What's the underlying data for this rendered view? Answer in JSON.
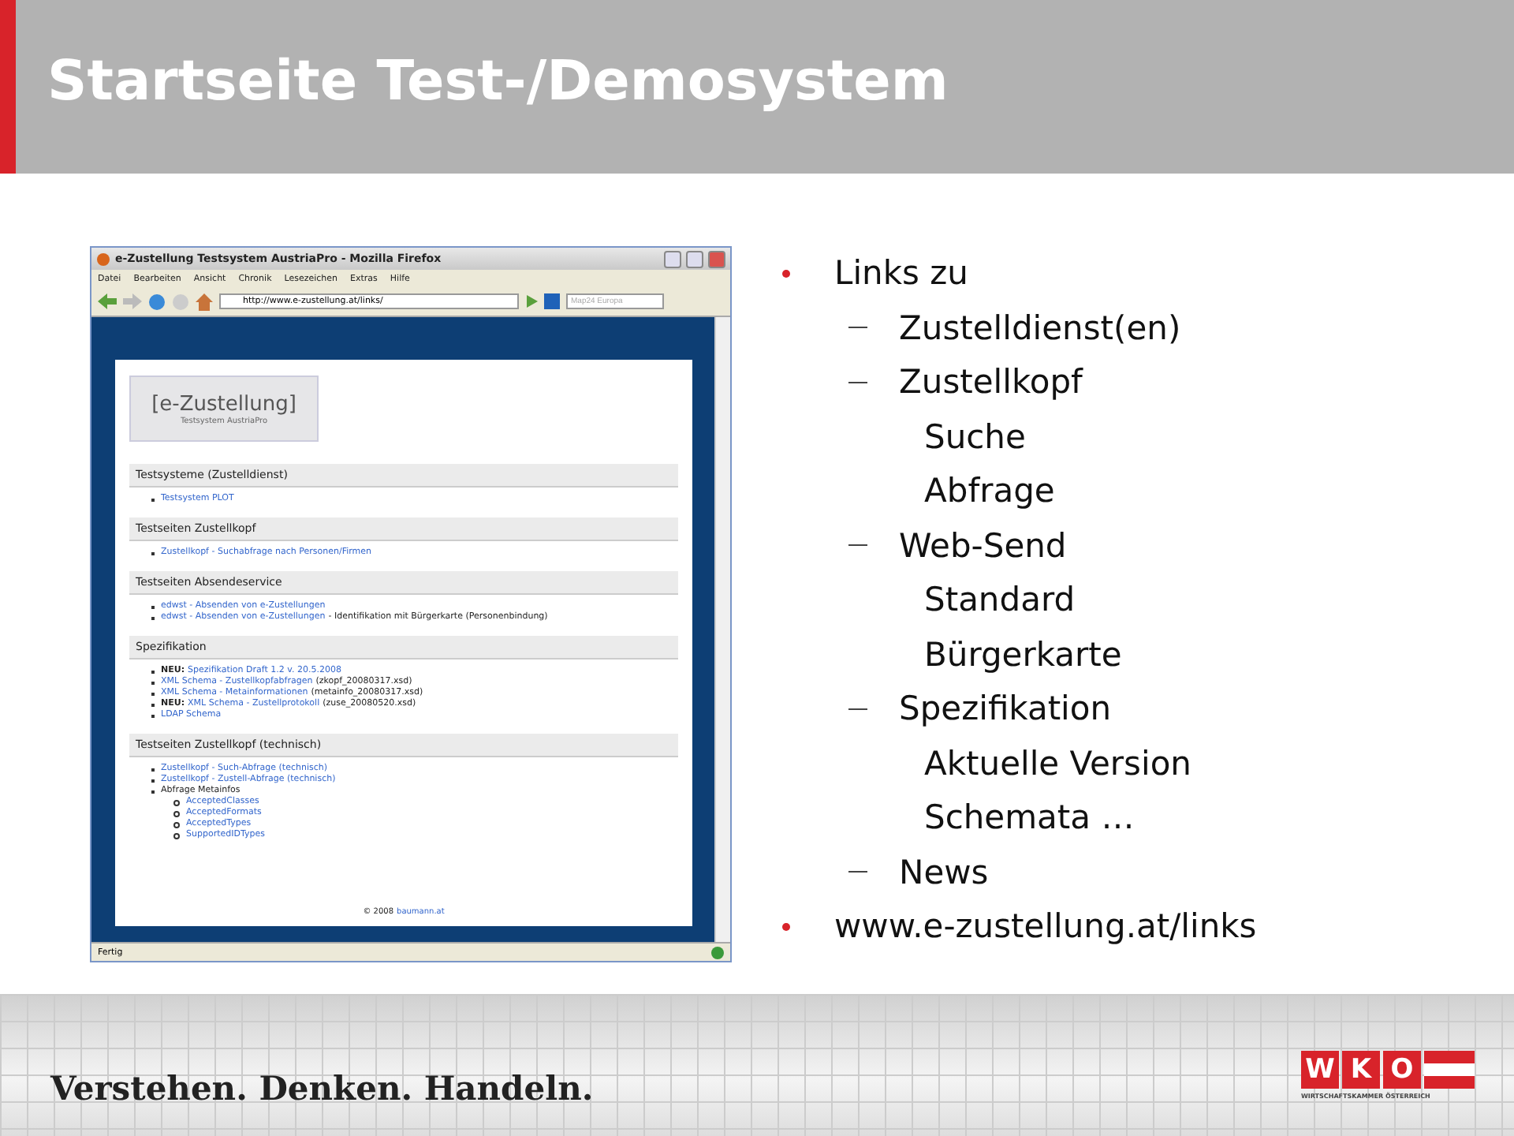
{
  "header": {
    "title": "Startseite Test-/Demosystem"
  },
  "browser": {
    "title": "e-Zustellung Testsystem AustriaPro - Mozilla Firefox",
    "menu": [
      "Datei",
      "Bearbeiten",
      "Ansicht",
      "Chronik",
      "Lesezeichen",
      "Extras",
      "Hilfe"
    ],
    "url": "http://www.e-zustellung.at/links/",
    "search": {
      "placeholder": "Map24 Europa"
    },
    "page": {
      "logo_title": "[e-Zustellung]",
      "logo_subtitle": "Testsystem AustriaPro",
      "sections": [
        {
          "heading": "Testsysteme (Zustelldienst)",
          "items": [
            {
              "link": "Testsystem PLOT"
            }
          ]
        },
        {
          "heading": "Testseiten Zustellkopf",
          "items": [
            {
              "link": "Zustellkopf - Suchabfrage nach Personen/Firmen"
            }
          ]
        },
        {
          "heading": "Testseiten Absendeservice",
          "items": [
            {
              "link": "edwst - Absenden von e-Zustellungen"
            },
            {
              "link": "edwst - Absenden von e-Zustellungen",
              "text": "- Identifikation mit Bürgerkarte (Personenbindung)"
            }
          ]
        },
        {
          "heading": "Spezifikation",
          "items": [
            {
              "label": "NEU:",
              "link": "Spezifikation Draft 1.2 v. 20.5.2008"
            },
            {
              "link": "XML Schema - Zustellkopfabfragen",
              "text": "(zkopf_20080317.xsd)"
            },
            {
              "link": "XML Schema - Metainformationen",
              "text": "(metainfo_20080317.xsd)"
            },
            {
              "label": "NEU:",
              "link": "XML Schema - Zustellprotokoll",
              "text": "(zuse_20080520.xsd)"
            },
            {
              "link": "LDAP Schema"
            }
          ]
        },
        {
          "heading": "Testseiten Zustellkopf (technisch)",
          "items": [
            {
              "link": "Zustellkopf - Such-Abfrage (technisch)"
            },
            {
              "link": "Zustellkopf - Zustell-Abfrage (technisch)"
            },
            {
              "text": "Abfrage Metainfos",
              "children": [
                {
                  "link": "AcceptedClasses"
                },
                {
                  "link": "AcceptedFormats"
                },
                {
                  "link": "AcceptedTypes"
                },
                {
                  "link": "SupportedIDTypes"
                }
              ]
            }
          ]
        }
      ],
      "footer": {
        "text": "© 2008",
        "link": "baumann.at"
      }
    },
    "status": "Fertig"
  },
  "bullets": [
    {
      "text": "Links zu",
      "children": [
        {
          "text": "Zustelldienst(en)"
        },
        {
          "text": "Zustellkopf",
          "children": [
            {
              "text": "Suche"
            },
            {
              "text": "Abfrage"
            }
          ]
        },
        {
          "text": "Web-Send",
          "children": [
            {
              "text": "Standard"
            },
            {
              "text": "Bürgerkarte"
            }
          ]
        },
        {
          "text": "Spezifikation",
          "children": [
            {
              "text": "Aktuelle Version"
            },
            {
              "text": "Schemata …"
            }
          ]
        },
        {
          "text": "News"
        }
      ]
    },
    {
      "text": "www.e-zustellung.at/links"
    }
  ],
  "footer": {
    "slogan": "Verstehen. Denken. Handeln.",
    "logo_letters": [
      "W",
      "K",
      "O"
    ],
    "logo_caption": "WIRTSCHAFTSKAMMER ÖSTERREICH"
  }
}
